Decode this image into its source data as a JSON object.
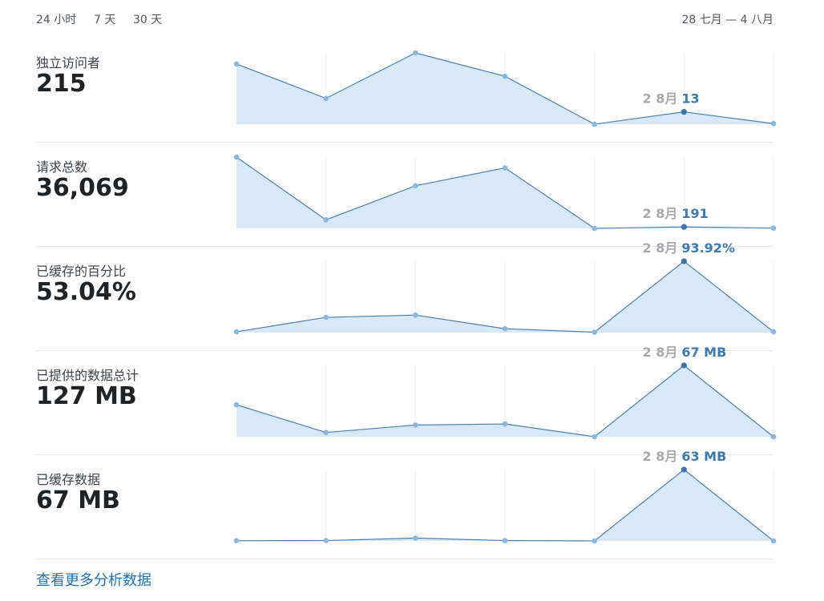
{
  "range_tabs": [
    "24 小时",
    "7 天",
    "30 天"
  ],
  "active_range_index": 1,
  "date_range": "28 七月 — 4 八月",
  "more_link": "查看更多分析数据",
  "colors": {
    "line": "#4a7fb5",
    "fill": "#d8e8f6",
    "point": "#8ab7e0",
    "highlight_point": "#3a74ab",
    "callout_date": "#a7aaad",
    "callout_value": "#3e79b0",
    "grid": "#eef0f2"
  },
  "metrics": [
    {
      "label": "独立访问者",
      "value": "215"
    },
    {
      "label": "请求总数",
      "value": "36,069"
    },
    {
      "label": "已缓存的百分比",
      "value": "53.04%"
    },
    {
      "label": "已提供的数据总计",
      "value": "127 MB"
    },
    {
      "label": "已缓存数据",
      "value": "67 MB"
    }
  ],
  "chart_data": [
    {
      "type": "area",
      "values": [
        49,
        21,
        58,
        39,
        0,
        10,
        0.5
      ],
      "ylim": [
        0,
        58
      ],
      "highlight_index": 5,
      "callout": {
        "date": "2 8月",
        "value": "13"
      }
    },
    {
      "type": "area",
      "values": [
        9200,
        1100,
        5500,
        7800,
        0,
        191,
        30
      ],
      "ylim": [
        0,
        9200
      ],
      "highlight_index": 5,
      "callout": {
        "date": "2 8月",
        "value": "191"
      }
    },
    {
      "type": "area",
      "values": [
        1.0,
        20,
        23,
        5,
        0.5,
        93.92,
        1
      ],
      "ylim": [
        0,
        93.92
      ],
      "highlight_index": 5,
      "callout": {
        "date": "2 8月",
        "value": "93.92%"
      }
    },
    {
      "type": "area",
      "values": [
        30,
        4,
        11,
        12,
        0,
        67,
        0
      ],
      "ylim": [
        0,
        67
      ],
      "highlight_index": 5,
      "callout": {
        "date": "2 8月",
        "value": "67 MB"
      }
    },
    {
      "type": "area",
      "values": [
        0.2,
        0.3,
        2.5,
        0.3,
        0,
        63,
        0
      ],
      "ylim": [
        0,
        63
      ],
      "highlight_index": 5,
      "callout": {
        "date": "2 8月",
        "value": "63 MB"
      }
    }
  ]
}
